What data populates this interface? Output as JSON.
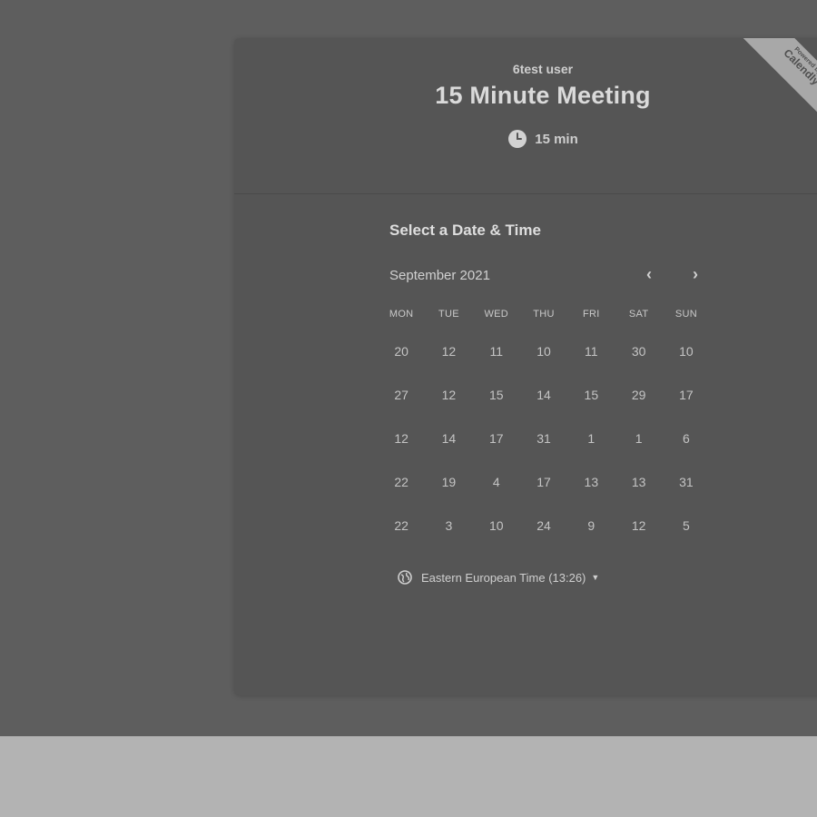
{
  "event": {
    "host": "6test user",
    "title": "15 Minute Meeting",
    "duration": "15 min"
  },
  "ribbon": {
    "line1": "Powered by",
    "line2": "Calendly"
  },
  "picker": {
    "heading": "Select a Date & Time",
    "month": "September 2021",
    "prev_icon": "chevron-left-icon",
    "next_icon": "chevron-right-icon",
    "weekdays": [
      "MON",
      "TUE",
      "WED",
      "THU",
      "FRI",
      "SAT",
      "SUN"
    ],
    "weeks": [
      [
        "20",
        "12",
        "11",
        "10",
        "11",
        "30",
        "10"
      ],
      [
        "27",
        "12",
        "15",
        "14",
        "15",
        "29",
        "17"
      ],
      [
        "12",
        "14",
        "17",
        "31",
        "1",
        "1",
        "6"
      ],
      [
        "22",
        "19",
        "4",
        "17",
        "13",
        "13",
        "31"
      ],
      [
        "22",
        "3",
        "10",
        "24",
        "9",
        "12",
        "5"
      ]
    ]
  },
  "timezone": {
    "label": "Eastern European Time (13:26)",
    "icon": "globe-icon"
  },
  "colors": {
    "backdrop": "#5e5e5e",
    "card": "#555555",
    "footer": "#b3b3b3"
  }
}
